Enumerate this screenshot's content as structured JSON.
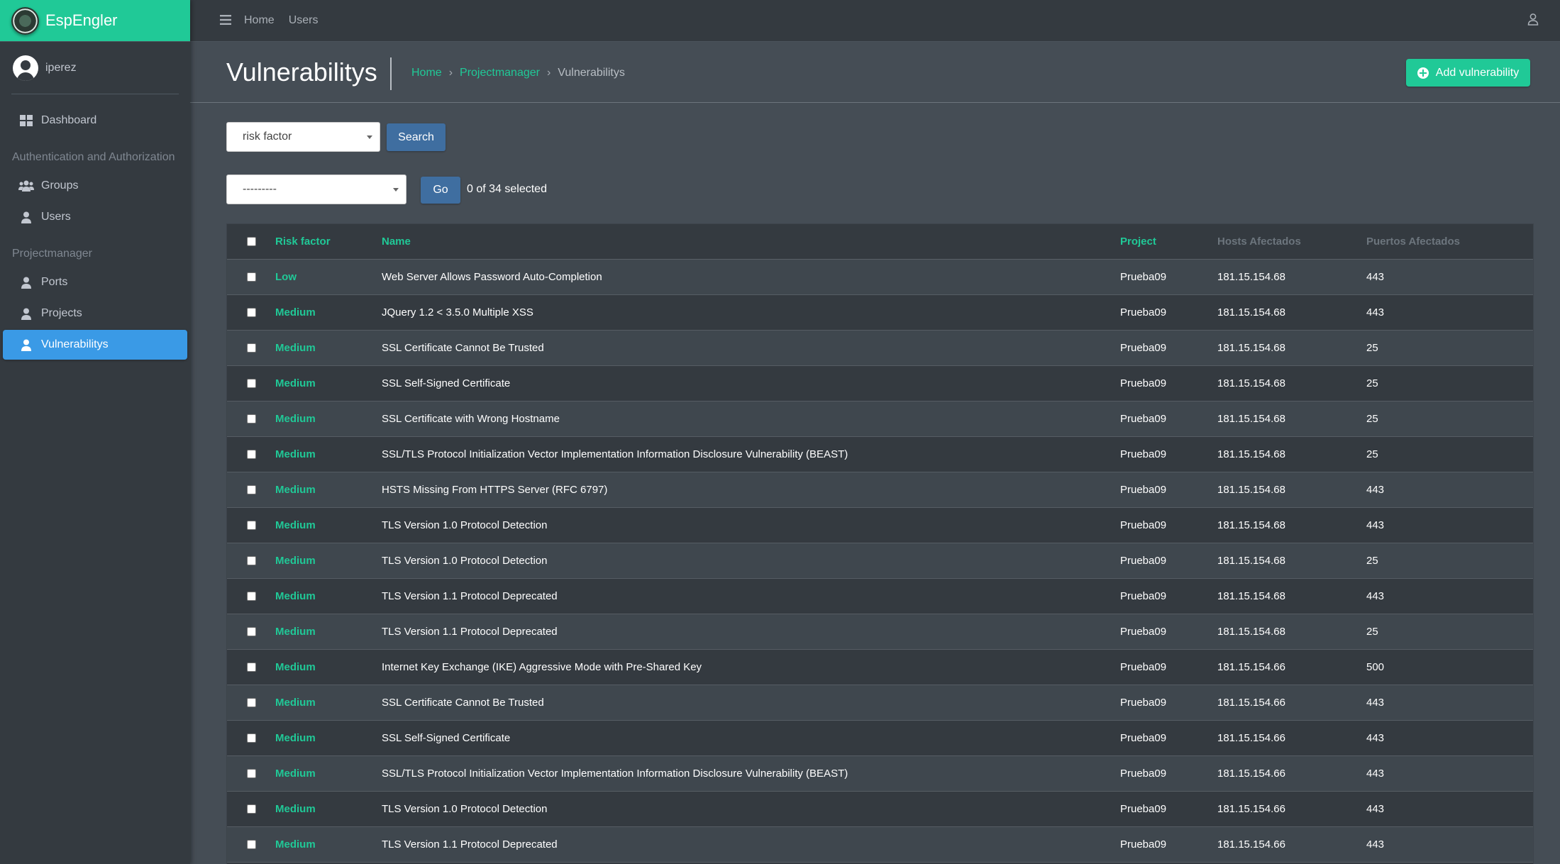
{
  "brand": {
    "name": "EspEngler"
  },
  "user": {
    "name": "iperez"
  },
  "sidebar": {
    "dashboard": "Dashboard",
    "section_auth": "Authentication and Authorization",
    "groups": "Groups",
    "users": "Users",
    "section_pm": "Projectmanager",
    "ports": "Ports",
    "projects": "Projects",
    "vulnerabilitys": "Vulnerabilitys"
  },
  "topbar": {
    "home": "Home",
    "users": "Users"
  },
  "page": {
    "title": "Vulnerabilitys",
    "breadcrumb": {
      "home": "Home",
      "projectmanager": "Projectmanager",
      "current": "Vulnerabilitys"
    },
    "add_button": "Add vulnerability"
  },
  "filters": {
    "search_field": "risk factor",
    "search_button": "Search",
    "action_select": "---------",
    "go_button": "Go",
    "selected_text": "0 of 34 selected"
  },
  "table": {
    "headers": {
      "risk": "Risk factor",
      "name": "Name",
      "project": "Project",
      "hosts": "Hosts Afectados",
      "ports": "Puertos Afectados"
    },
    "rows": [
      {
        "risk": "Low",
        "name": "Web Server Allows Password Auto-Completion",
        "project": "Prueba09",
        "host": "181.15.154.68",
        "port": "443"
      },
      {
        "risk": "Medium",
        "name": "JQuery 1.2 < 3.5.0 Multiple XSS",
        "project": "Prueba09",
        "host": "181.15.154.68",
        "port": "443"
      },
      {
        "risk": "Medium",
        "name": "SSL Certificate Cannot Be Trusted",
        "project": "Prueba09",
        "host": "181.15.154.68",
        "port": "25"
      },
      {
        "risk": "Medium",
        "name": "SSL Self-Signed Certificate",
        "project": "Prueba09",
        "host": "181.15.154.68",
        "port": "25"
      },
      {
        "risk": "Medium",
        "name": "SSL Certificate with Wrong Hostname",
        "project": "Prueba09",
        "host": "181.15.154.68",
        "port": "25"
      },
      {
        "risk": "Medium",
        "name": "SSL/TLS Protocol Initialization Vector Implementation Information Disclosure Vulnerability (BEAST)",
        "project": "Prueba09",
        "host": "181.15.154.68",
        "port": "25"
      },
      {
        "risk": "Medium",
        "name": "HSTS Missing From HTTPS Server (RFC 6797)",
        "project": "Prueba09",
        "host": "181.15.154.68",
        "port": "443"
      },
      {
        "risk": "Medium",
        "name": "TLS Version 1.0 Protocol Detection",
        "project": "Prueba09",
        "host": "181.15.154.68",
        "port": "443"
      },
      {
        "risk": "Medium",
        "name": "TLS Version 1.0 Protocol Detection",
        "project": "Prueba09",
        "host": "181.15.154.68",
        "port": "25"
      },
      {
        "risk": "Medium",
        "name": "TLS Version 1.1 Protocol Deprecated",
        "project": "Prueba09",
        "host": "181.15.154.68",
        "port": "443"
      },
      {
        "risk": "Medium",
        "name": "TLS Version 1.1 Protocol Deprecated",
        "project": "Prueba09",
        "host": "181.15.154.68",
        "port": "25"
      },
      {
        "risk": "Medium",
        "name": "Internet Key Exchange (IKE) Aggressive Mode with Pre-Shared Key",
        "project": "Prueba09",
        "host": "181.15.154.66",
        "port": "500"
      },
      {
        "risk": "Medium",
        "name": "SSL Certificate Cannot Be Trusted",
        "project": "Prueba09",
        "host": "181.15.154.66",
        "port": "443"
      },
      {
        "risk": "Medium",
        "name": "SSL Self-Signed Certificate",
        "project": "Prueba09",
        "host": "181.15.154.66",
        "port": "443"
      },
      {
        "risk": "Medium",
        "name": "SSL/TLS Protocol Initialization Vector Implementation Information Disclosure Vulnerability (BEAST)",
        "project": "Prueba09",
        "host": "181.15.154.66",
        "port": "443"
      },
      {
        "risk": "Medium",
        "name": "TLS Version 1.0 Protocol Detection",
        "project": "Prueba09",
        "host": "181.15.154.66",
        "port": "443"
      },
      {
        "risk": "Medium",
        "name": "TLS Version 1.1 Protocol Deprecated",
        "project": "Prueba09",
        "host": "181.15.154.66",
        "port": "443"
      }
    ]
  },
  "colors": {
    "accent": "#20c997",
    "active_nav": "#3a9ae6",
    "button_blue": "#3f6ea0",
    "background": "#454d55",
    "sidebar": "#343a40"
  }
}
